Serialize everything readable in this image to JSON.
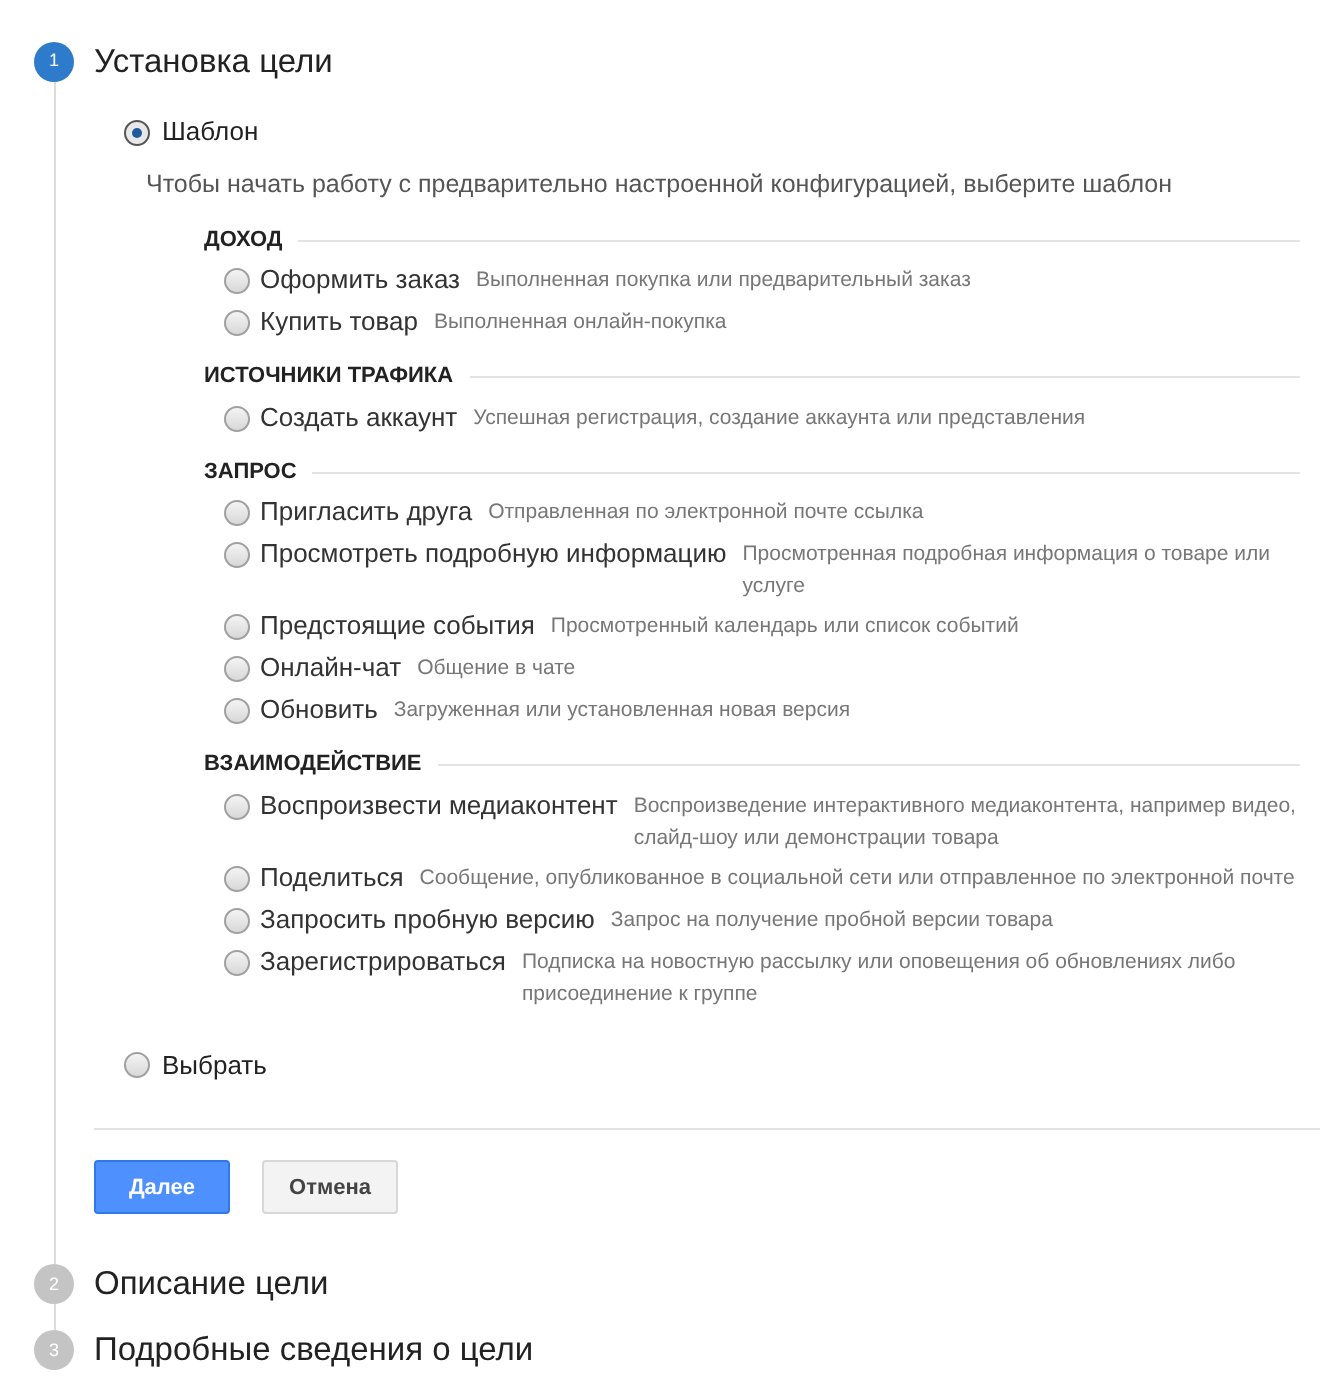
{
  "steps": [
    {
      "number": "1",
      "title": "Установка цели",
      "active": true,
      "content": {
        "template_option": {
          "label": "Шаблон",
          "selected": true
        },
        "hint": "Чтобы начать работу с предварительно настроенной конфигурацией, выберите шаблон",
        "sections": [
          {
            "heading": "ДОХОД",
            "options": [
              {
                "label": "Оформить заказ",
                "description": "Выполненная покупка или предварительный заказ",
                "selected": false
              },
              {
                "label": "Купить товар",
                "description": "Выполненная онлайн-покупка",
                "selected": false
              }
            ]
          },
          {
            "heading": "ИСТОЧНИКИ ТРАФИКА",
            "options": [
              {
                "label": "Создать аккаунт",
                "description": "Успешная регистрация, создание аккаунта или представления",
                "selected": false
              }
            ]
          },
          {
            "heading": "ЗАПРОС",
            "options": [
              {
                "label": "Пригласить друга",
                "description": "Отправленная по электронной почте ссылка",
                "selected": false
              },
              {
                "label": "Просмотреть подробную информацию",
                "description": "Просмотренная подробная информация о товаре или услуге",
                "selected": false
              },
              {
                "label": "Предстоящие события",
                "description": "Просмотренный календарь или список событий",
                "selected": false
              },
              {
                "label": "Онлайн-чат",
                "description": "Общение в чате",
                "selected": false
              },
              {
                "label": "Обновить",
                "description": "Загруженная или установленная новая версия",
                "selected": false
              }
            ]
          },
          {
            "heading": "ВЗАИМОДЕЙСТВИЕ",
            "options": [
              {
                "label": "Воспроизвести медиаконтент",
                "description": "Воспроизведение интерактивного медиаконтента, например видео, слайд-шоу или демонстрации товара",
                "selected": false
              },
              {
                "label": "Поделиться",
                "description": "Сообщение, опубликованное в социальной сети или отправленное по электронной почте",
                "selected": false
              },
              {
                "label": "Запросить пробную версию",
                "description": "Запрос на получение пробной версии товара",
                "selected": false
              },
              {
                "label": "Зарегистрироваться",
                "description": "Подписка на новостную рассылку или оповещения об обновлениях либо присоединение к группе",
                "selected": false
              }
            ]
          }
        ],
        "custom_option": {
          "label": "Выбрать",
          "selected": false
        },
        "buttons": [
          {
            "label": "Далее",
            "kind": "primary"
          },
          {
            "label": "Отмена",
            "kind": "secondary"
          }
        ]
      }
    },
    {
      "number": "2",
      "title": "Описание цели",
      "active": false
    },
    {
      "number": "3",
      "title": "Подробные сведения о цели",
      "active": false
    }
  ]
}
